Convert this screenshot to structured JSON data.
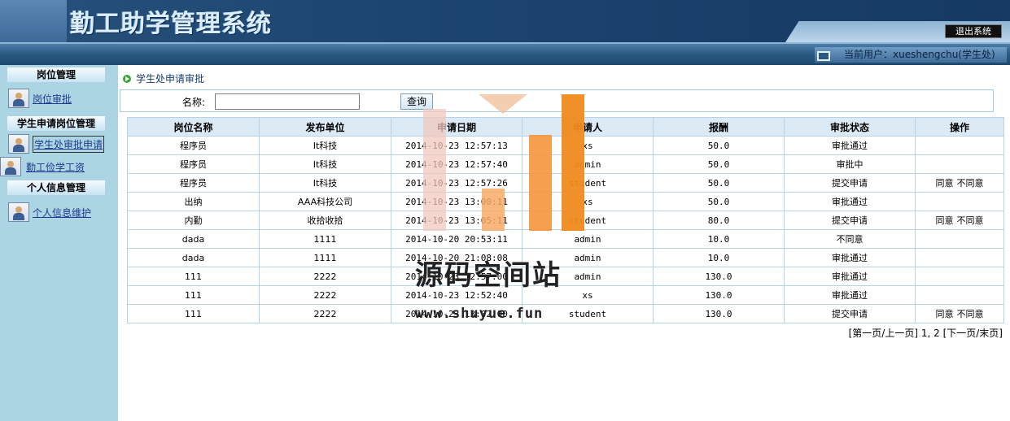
{
  "header": {
    "title": "勤工助学管理系统",
    "logout_label": "退出系统"
  },
  "infobar": {
    "current_user": "当前用户：xueshengchu(学生处)"
  },
  "sidebar": {
    "groups": [
      {
        "title": "岗位管理",
        "items": [
          {
            "label": "岗位审批"
          }
        ]
      },
      {
        "title": "学生申请岗位管理",
        "items": [
          {
            "label": "学生处审批申请"
          },
          {
            "label": "勤工俭学工资"
          }
        ]
      },
      {
        "title": "个人信息管理",
        "items": [
          {
            "label": "个人信息维护"
          }
        ]
      }
    ]
  },
  "breadcrumb": "学生处申请审批",
  "search": {
    "label": "名称:",
    "value": "",
    "button": "查询"
  },
  "table": {
    "columns": [
      "岗位名称",
      "发布单位",
      "申请日期",
      "申请人",
      "报酬",
      "审批状态",
      "操作"
    ],
    "rows": [
      {
        "name": "程序员",
        "unit": "It科技",
        "date": "2014-10-23 12:57:13",
        "applicant": "xs",
        "pay": "50.0",
        "status": "审批通过",
        "actions": []
      },
      {
        "name": "程序员",
        "unit": "It科技",
        "date": "2014-10-23 12:57:40",
        "applicant": "admin",
        "pay": "50.0",
        "status": "审批中",
        "actions": []
      },
      {
        "name": "程序员",
        "unit": "It科技",
        "date": "2014-10-23 12:57:26",
        "applicant": "student",
        "pay": "50.0",
        "status": "提交申请",
        "actions": [
          "同意",
          "不同意"
        ]
      },
      {
        "name": "出纳",
        "unit": "AAA科技公司",
        "date": "2014-10-23 13:00:11",
        "applicant": "xs",
        "pay": "50.0",
        "status": "审批通过",
        "actions": []
      },
      {
        "name": "内勤",
        "unit": "收拾收拾",
        "date": "2014-10-23 13:05:11",
        "applicant": "student",
        "pay": "80.0",
        "status": "提交申请",
        "actions": [
          "同意",
          "不同意"
        ]
      },
      {
        "name": "dada",
        "unit": "1111",
        "date": "2014-10-20 20:53:11",
        "applicant": "admin",
        "pay": "10.0",
        "status": "不同意",
        "actions": []
      },
      {
        "name": "dada",
        "unit": "1111",
        "date": "2014-10-20 21:08:08",
        "applicant": "admin",
        "pay": "10.0",
        "status": "审批通过",
        "actions": []
      },
      {
        "name": "111",
        "unit": "2222",
        "date": "2014-10-23 12:57:00",
        "applicant": "admin",
        "pay": "130.0",
        "status": "审批通过",
        "actions": []
      },
      {
        "name": "111",
        "unit": "2222",
        "date": "2014-10-23 12:52:40",
        "applicant": "xs",
        "pay": "130.0",
        "status": "审批通过",
        "actions": []
      },
      {
        "name": "111",
        "unit": "2222",
        "date": "2014-10-23 13:02:00",
        "applicant": "student",
        "pay": "130.0",
        "status": "提交申请",
        "actions": [
          "同意",
          "不同意"
        ]
      }
    ]
  },
  "pager": {
    "first_prev": "[第一页/上一页]",
    "pages": "1, 2",
    "next_last": "[下一页/末页]"
  },
  "watermark": {
    "text": "源码空间站",
    "url": "www.shuyue.fun"
  },
  "colors": {
    "sidebar_bg": "#acd5e3",
    "header_dark": "#163a63",
    "link": "#1e3a8c",
    "table_header": "#dbeaf4",
    "watermark_orange": "#f08a1c"
  }
}
